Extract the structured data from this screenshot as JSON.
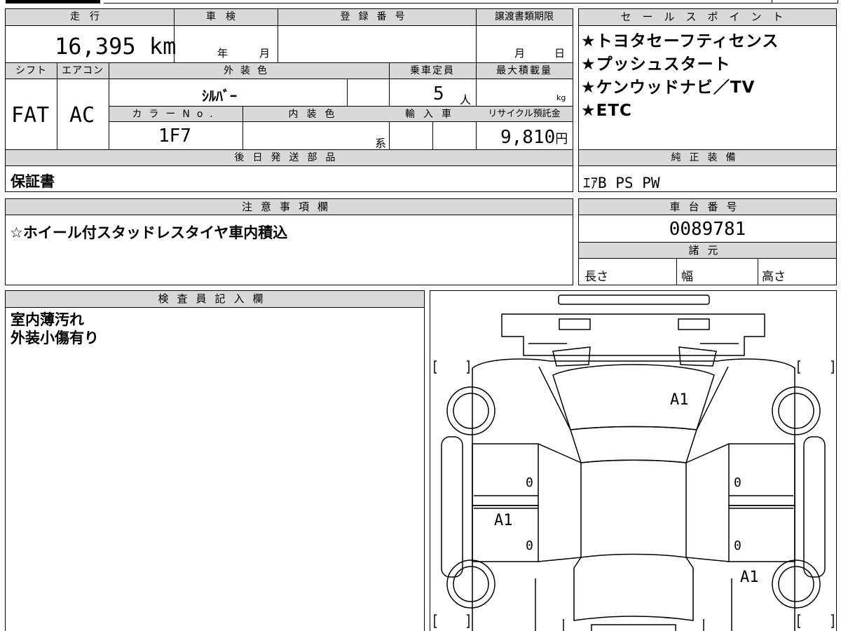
{
  "headers": {
    "mileage": "走行",
    "inspection": "車検",
    "registration": "登録番号",
    "transfer_deadline": "譲渡書類期限",
    "sales_points": "セールスポイント",
    "shift": "シフト",
    "aircon": "エアコン",
    "exterior_color": "外装色",
    "capacity": "乗車定員",
    "max_load": "最大積載量",
    "color_no": "カラーNo.",
    "interior_color": "内装色",
    "import": "輸入車",
    "recycle": "リサイクル預託金",
    "later_parts": "後日発送部品",
    "genuine_equipment": "純正装備",
    "notes": "注意事項欄",
    "chassis_no": "車台番号",
    "specs": "諸元",
    "inspector": "検査員記入欄"
  },
  "vehicle": {
    "mileage": "16,395",
    "mileage_unit": "km",
    "inspection_year_label": "年",
    "inspection_month_label": "月",
    "transfer_month_label": "月",
    "transfer_day_label": "日",
    "shift": "FAT",
    "aircon": "AC",
    "exterior_color": "ｼﾙﾊﾞｰ",
    "capacity": "5",
    "capacity_unit": "人",
    "max_load_unit": "kg",
    "color_no": "1F7",
    "interior_color_suffix": "系",
    "recycle_fee": "9,810",
    "recycle_unit": "円",
    "chassis_no": "0089781",
    "spec_length": "長さ",
    "spec_width": "幅",
    "spec_height": "高さ"
  },
  "sales_points": [
    "★トヨタセーフティセンス",
    "★プッシュスタート",
    "★ケンウッドナビ／TV",
    "★ETC"
  ],
  "later_parts": "保証書",
  "genuine_equipment": "ｴｱB PS PW",
  "notes": "☆ホイール付スタッドレスタイヤ車内積込",
  "inspector_notes": [
    "室内薄汚れ",
    "外装小傷有り"
  ],
  "diagram_marks": {
    "roof": "A1",
    "left_front_door_lower": "A1",
    "rear_right": "A1",
    "zero": "0"
  }
}
